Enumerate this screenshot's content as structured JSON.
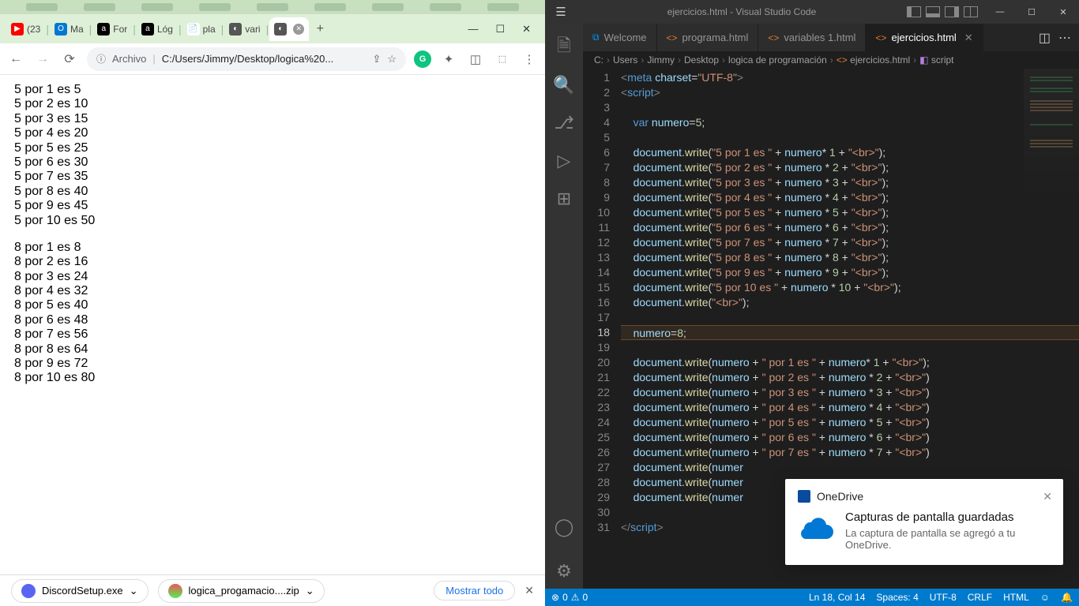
{
  "chrome": {
    "tabs": [
      {
        "fav": "▶",
        "favbg": "#f00",
        "favfg": "#fff",
        "title": "(23"
      },
      {
        "fav": "O",
        "favbg": "#0078d4",
        "favfg": "#fff",
        "title": "Ma"
      },
      {
        "fav": "a",
        "favbg": "#000",
        "favfg": "#fff",
        "title": "For"
      },
      {
        "fav": "a",
        "favbg": "#000",
        "favfg": "#fff",
        "title": "Lóg"
      },
      {
        "fav": "📄",
        "favbg": "#fff",
        "favfg": "#888",
        "title": "pla"
      },
      {
        "fav": "◐",
        "favbg": "#555",
        "favfg": "#fff",
        "title": "vari"
      },
      {
        "fav": "◐",
        "favbg": "#555",
        "favfg": "#fff",
        "title": ""
      }
    ],
    "addr_label": "Archivo",
    "addr_path": "C:/Users/Jimmy/Desktop/logica%20...",
    "output_lines_a": [
      "5 por 1 es 5",
      "5 por 2 es 10",
      "5 por 3 es 15",
      "5 por 4 es 20",
      "5 por 5 es 25",
      "5 por 6 es 30",
      "5 por 7 es 35",
      "5 por 8 es 40",
      "5 por 9 es 45",
      "5 por 10 es 50"
    ],
    "output_lines_b": [
      "8 por 1 es 8",
      "8 por 2 es 16",
      "8 por 3 es 24",
      "8 por 4 es 32",
      "8 por 5 es 40",
      "8 por 6 es 48",
      "8 por 7 es 56",
      "8 por 8 es 64",
      "8 por 9 es 72",
      "8 por 10 es 80"
    ],
    "dl1": "DiscordSetup.exe",
    "dl2": "logica_progamacio....zip",
    "show_all": "Mostrar todo"
  },
  "vscode": {
    "window_title": "ejercicios.html - Visual Studio Code",
    "tabs": [
      {
        "icon": "vsco",
        "label": "Welcome",
        "active": false
      },
      {
        "icon": "eico",
        "label": "programa.html",
        "active": false
      },
      {
        "icon": "eico",
        "label": "variables 1.html",
        "active": false
      },
      {
        "icon": "eico",
        "label": "ejercicios.html",
        "active": true
      }
    ],
    "breadcrumbs": [
      "C:",
      "Users",
      "Jimmy",
      "Desktop",
      "logica de programación",
      "ejercicios.html",
      "script"
    ],
    "code": [
      {
        "n": 1,
        "html": "<span class='tok-br'>&lt;</span><span class='tok-tag'>meta</span> <span class='tok-attr'>charset</span>=<span class='tok-str'>\"UTF-8\"</span><span class='tok-br'>&gt;</span>"
      },
      {
        "n": 2,
        "html": "<span class='tok-br'>&lt;</span><span class='tok-tag'>script</span><span class='tok-br'>&gt;</span>"
      },
      {
        "n": 3,
        "html": ""
      },
      {
        "n": 4,
        "html": "    <span class='tok-kw'>var</span> <span class='tok-var'>numero</span>=<span class='tok-num'>5</span>;"
      },
      {
        "n": 5,
        "html": ""
      },
      {
        "n": 6,
        "html": "    <span class='tok-obj'>document</span>.<span class='tok-fn'>write</span>(<span class='tok-str'>\"5 por 1 es \"</span> + <span class='tok-var'>numero</span>* <span class='tok-num'>1</span> + <span class='tok-str'>\"&lt;br&gt;\"</span>);"
      },
      {
        "n": 7,
        "html": "    <span class='tok-obj'>document</span>.<span class='tok-fn'>write</span>(<span class='tok-str'>\"5 por 2 es \"</span> + <span class='tok-var'>numero</span> * <span class='tok-num'>2</span> + <span class='tok-str'>\"&lt;br&gt;\"</span>);"
      },
      {
        "n": 8,
        "html": "    <span class='tok-obj'>document</span>.<span class='tok-fn'>write</span>(<span class='tok-str'>\"5 por 3 es \"</span> + <span class='tok-var'>numero</span> * <span class='tok-num'>3</span> + <span class='tok-str'>\"&lt;br&gt;\"</span>);"
      },
      {
        "n": 9,
        "html": "    <span class='tok-obj'>document</span>.<span class='tok-fn'>write</span>(<span class='tok-str'>\"5 por 4 es \"</span> + <span class='tok-var'>numero</span> * <span class='tok-num'>4</span> + <span class='tok-str'>\"&lt;br&gt;\"</span>);"
      },
      {
        "n": 10,
        "html": "    <span class='tok-obj'>document</span>.<span class='tok-fn'>write</span>(<span class='tok-str'>\"5 por 5 es \"</span> + <span class='tok-var'>numero</span> * <span class='tok-num'>5</span> + <span class='tok-str'>\"&lt;br&gt;\"</span>);"
      },
      {
        "n": 11,
        "html": "    <span class='tok-obj'>document</span>.<span class='tok-fn'>write</span>(<span class='tok-str'>\"5 por 6 es \"</span> + <span class='tok-var'>numero</span> * <span class='tok-num'>6</span> + <span class='tok-str'>\"&lt;br&gt;\"</span>);"
      },
      {
        "n": 12,
        "html": "    <span class='tok-obj'>document</span>.<span class='tok-fn'>write</span>(<span class='tok-str'>\"5 por 7 es \"</span> + <span class='tok-var'>numero</span> * <span class='tok-num'>7</span> + <span class='tok-str'>\"&lt;br&gt;\"</span>);"
      },
      {
        "n": 13,
        "html": "    <span class='tok-obj'>document</span>.<span class='tok-fn'>write</span>(<span class='tok-str'>\"5 por 8 es \"</span> + <span class='tok-var'>numero</span> * <span class='tok-num'>8</span> + <span class='tok-str'>\"&lt;br&gt;\"</span>);"
      },
      {
        "n": 14,
        "html": "    <span class='tok-obj'>document</span>.<span class='tok-fn'>write</span>(<span class='tok-str'>\"5 por 9 es \"</span> + <span class='tok-var'>numero</span> * <span class='tok-num'>9</span> + <span class='tok-str'>\"&lt;br&gt;\"</span>);"
      },
      {
        "n": 15,
        "html": "    <span class='tok-obj'>document</span>.<span class='tok-fn'>write</span>(<span class='tok-str'>\"5 por 10 es \"</span> + <span class='tok-var'>numero</span> * <span class='tok-num'>10</span> + <span class='tok-str'>\"&lt;br&gt;\"</span>);"
      },
      {
        "n": 16,
        "html": "    <span class='tok-obj'>document</span>.<span class='tok-fn'>write</span>(<span class='tok-str'>\"&lt;br&gt;\"</span>);"
      },
      {
        "n": 17,
        "html": ""
      },
      {
        "n": 18,
        "html": "    <span class='tok-var'>numero</span>=<span class='tok-num'>8</span>;",
        "cl": "hlrow"
      },
      {
        "n": 19,
        "html": ""
      },
      {
        "n": 20,
        "html": "    <span class='tok-obj'>document</span>.<span class='tok-fn'>write</span>(<span class='tok-var'>numero</span> + <span class='tok-str'>\" por 1 es \"</span> + <span class='tok-var'>numero</span>* <span class='tok-num'>1</span> + <span class='tok-str'>\"&lt;br&gt;\"</span>);"
      },
      {
        "n": 21,
        "html": "    <span class='tok-obj'>document</span>.<span class='tok-fn'>write</span>(<span class='tok-var'>numero</span> + <span class='tok-str'>\" por 2 es \"</span> + <span class='tok-var'>numero</span> * <span class='tok-num'>2</span> + <span class='tok-str'>\"&lt;br&gt;\"</span>)"
      },
      {
        "n": 22,
        "html": "    <span class='tok-obj'>document</span>.<span class='tok-fn'>write</span>(<span class='tok-var'>numero</span> + <span class='tok-str'>\" por 3 es \"</span> + <span class='tok-var'>numero</span> * <span class='tok-num'>3</span> + <span class='tok-str'>\"&lt;br&gt;\"</span>)"
      },
      {
        "n": 23,
        "html": "    <span class='tok-obj'>document</span>.<span class='tok-fn'>write</span>(<span class='tok-var'>numero</span> + <span class='tok-str'>\" por 4 es \"</span> + <span class='tok-var'>numero</span> * <span class='tok-num'>4</span> + <span class='tok-str'>\"&lt;br&gt;\"</span>)"
      },
      {
        "n": 24,
        "html": "    <span class='tok-obj'>document</span>.<span class='tok-fn'>write</span>(<span class='tok-var'>numero</span> + <span class='tok-str'>\" por 5 es \"</span> + <span class='tok-var'>numero</span> * <span class='tok-num'>5</span> + <span class='tok-str'>\"&lt;br&gt;\"</span>)"
      },
      {
        "n": 25,
        "html": "    <span class='tok-obj'>document</span>.<span class='tok-fn'>write</span>(<span class='tok-var'>numero</span> + <span class='tok-str'>\" por 6 es \"</span> + <span class='tok-var'>numero</span> * <span class='tok-num'>6</span> + <span class='tok-str'>\"&lt;br&gt;\"</span>)"
      },
      {
        "n": 26,
        "html": "    <span class='tok-obj'>document</span>.<span class='tok-fn'>write</span>(<span class='tok-var'>numero</span> + <span class='tok-str'>\" por 7 es \"</span> + <span class='tok-var'>numero</span> * <span class='tok-num'>7</span> + <span class='tok-str'>\"&lt;br&gt;\"</span>)"
      },
      {
        "n": 27,
        "html": "    <span class='tok-obj'>document</span>.<span class='tok-fn'>write</span>(<span class='tok-var'>numer</span>"
      },
      {
        "n": 28,
        "html": "    <span class='tok-obj'>document</span>.<span class='tok-fn'>write</span>(<span class='tok-var'>numer</span>"
      },
      {
        "n": 29,
        "html": "    <span class='tok-obj'>document</span>.<span class='tok-fn'>write</span>(<span class='tok-var'>numer</span>"
      },
      {
        "n": 30,
        "html": ""
      },
      {
        "n": 31,
        "html": "<span class='tok-br'>&lt;/</span><span class='tok-tag'>script</span><span class='tok-br'>&gt;</span>"
      }
    ],
    "status": {
      "errors": "0",
      "warnings": "0",
      "lncol": "Ln 18, Col 14",
      "spaces": "Spaces: 4",
      "enc": "UTF-8",
      "eol": "CRLF",
      "lang": "HTML"
    }
  },
  "toast": {
    "app": "OneDrive",
    "title": "Capturas de pantalla guardadas",
    "body": "La captura de pantalla se agregó a tu OneDrive."
  }
}
